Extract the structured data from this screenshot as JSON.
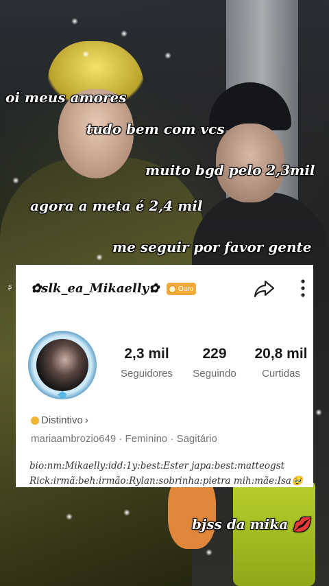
{
  "captions": [
    "oi meus amores",
    "tudo bem com vcs",
    "muito bgd pelo 2,3mil",
    "agora a meta é 2,4 mil",
    "me seguir por favor gente",
    "bjss da mika 💋"
  ],
  "profile": {
    "username": "✿slk_ea_Mikaelly✿",
    "badge_label": "Ouro",
    "stats": [
      {
        "value": "2,3 mil",
        "label": "Seguidores"
      },
      {
        "value": "229",
        "label": "Seguindo"
      },
      {
        "value": "20,8 mil",
        "label": "Curtidas"
      }
    ],
    "distintivo_label": "Distintivo",
    "distintivo_chevron": "›",
    "meta_line": "mariaambrozio649 · Feminino · Sagitário",
    "bio_line1": "bio:nm:Mikaelly:idd:1y:best:Ester japa:best:matteogst",
    "bio_line2": "Rick:irmã:beh:irmão:Rylan:sobrinha:pietra mih:mãe:Isa🥹"
  },
  "icons": {
    "share": "share-arrow-icon",
    "more": "vertical-dots-icon",
    "badge": "gold-coin-icon"
  },
  "colors": {
    "badge_bg": "#f2a93b",
    "card_bg": "#ffffff",
    "caption_text": "#ffffff"
  }
}
